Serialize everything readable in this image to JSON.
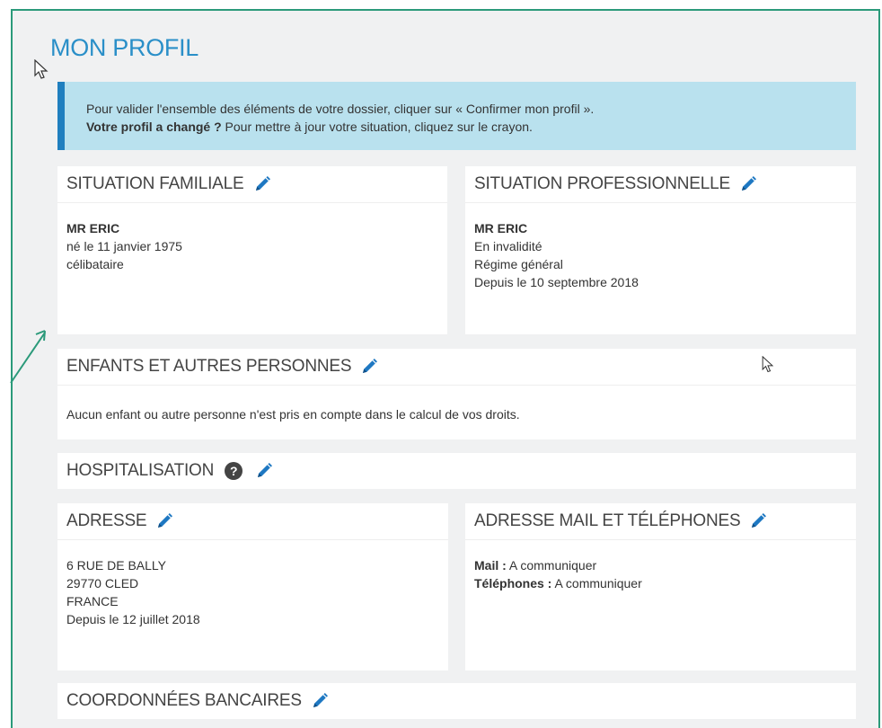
{
  "page": {
    "title": "MON PROFIL"
  },
  "alert": {
    "line1": "Pour valider l'ensemble des éléments de votre dossier, cliquer sur « Confirmer mon profil ».",
    "line2_bold": "Votre profil a changé ?",
    "line2_rest": " Pour mettre à jour votre situation, cliquez sur le crayon."
  },
  "famille": {
    "title": "SITUATION FAMILIALE",
    "name": "MR ERIC",
    "birth": "né le 11 janvier 1975",
    "status": "célibataire"
  },
  "pro": {
    "title": "SITUATION PROFESSIONNELLE",
    "name": "MR ERIC",
    "line1": "En invalidité",
    "line2": "Régime général",
    "line3": "Depuis le 10 septembre 2018"
  },
  "enfants": {
    "title": "ENFANTS ET AUTRES PERSONNES",
    "text": "Aucun enfant ou autre personne n'est pris en compte dans le calcul de vos droits."
  },
  "hospitalisation": {
    "title": "HOSPITALISATION",
    "help": "?"
  },
  "adresse": {
    "title": "ADRESSE",
    "line1": "6 RUE DE BALLY",
    "line2": "29770 CLED",
    "line3": "FRANCE",
    "line4": "Depuis le 12 juillet 2018"
  },
  "contact": {
    "title": "ADRESSE MAIL ET TÉLÉPHONES",
    "mail_label": "Mail :",
    "mail_value": " A communiquer",
    "tel_label": "Téléphones :",
    "tel_value": " A communiquer"
  },
  "banque": {
    "title": "COORDONNÉES BANCAIRES"
  },
  "colors": {
    "accent": "#2a8fc8",
    "alert_bg": "#b9e1ee",
    "alert_bar": "#1f7fbf",
    "frame": "#2b9a7a",
    "page_bg": "#f0f1f2"
  },
  "icons": [
    "pencil-icon",
    "help-icon",
    "mouse-cursor-icon",
    "callout-arrow"
  ]
}
